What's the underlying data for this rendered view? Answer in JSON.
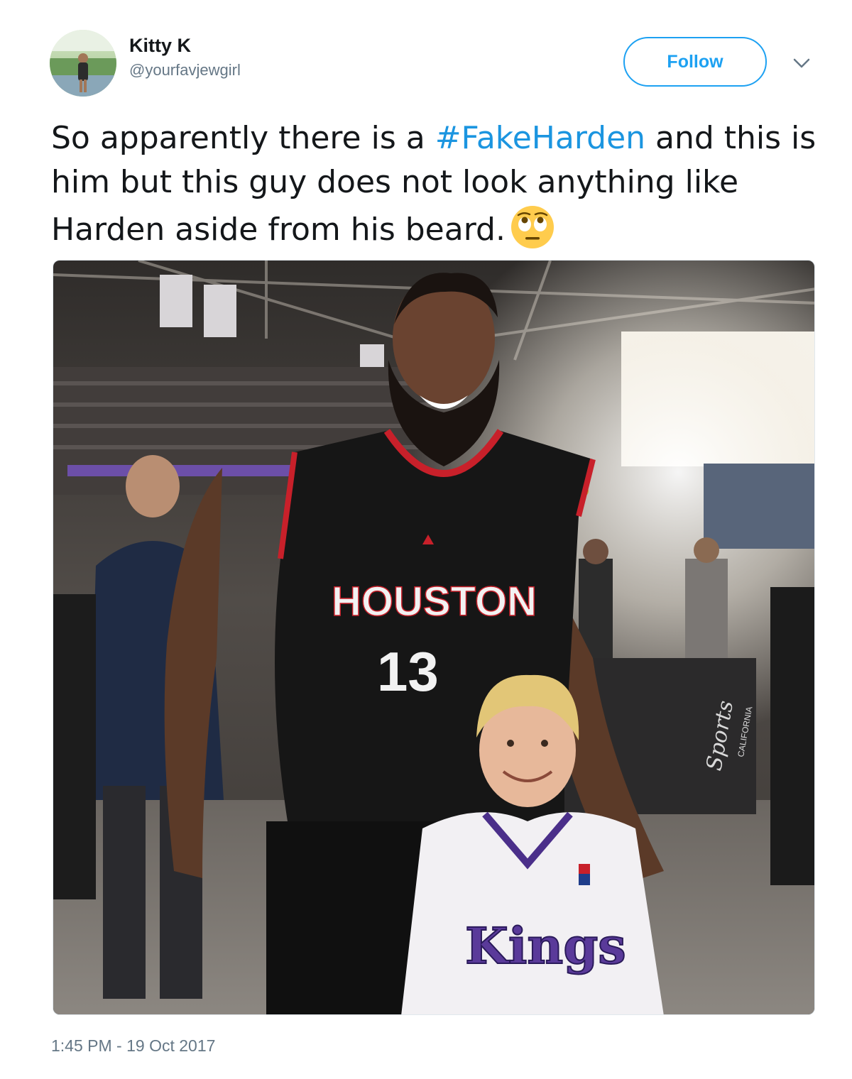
{
  "tweet": {
    "author": {
      "display_name": "Kitty K",
      "handle": "@yourfavjewgirl",
      "avatar_icon": "user-avatar"
    },
    "follow_label": "Follow",
    "menu_icon": "chevron-down-icon",
    "text_before": "So apparently there is a ",
    "hashtag": "#FakeHarden",
    "text_after": " and this is him but this guy does not look anything like Harden aside from his beard.",
    "emoji": "face-with-rolling-eyes",
    "timestamp": "1:45 PM - 19 Oct 2017",
    "colors": {
      "accent": "#1da1f2",
      "hashtag": "#1b95e0",
      "muted": "#657786"
    }
  },
  "photo": {
    "jersey_team": "HOUSTON",
    "jersey_number": "13",
    "kid_jersey_team": "Kings",
    "signage_text": "Sports",
    "signage_subtext": "CALIFORNIA"
  }
}
